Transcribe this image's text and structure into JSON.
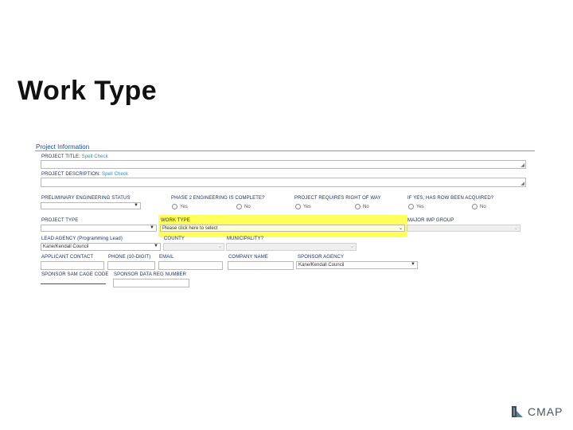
{
  "slide": {
    "title": "Work Type"
  },
  "form": {
    "section_title": "Project Information",
    "project_title": {
      "label": "PROJECT TITLE:",
      "spell": "Spell Check"
    },
    "project_description": {
      "label": "PROJECT DESCRIPTION:",
      "spell": "Spell Check"
    },
    "prelim_eng_status": {
      "label": "PRELIMINARY ENGINEERING STATUS"
    },
    "phase2_complete": {
      "label": "PHASE 2 ENGINEERING IS COMPLETE?",
      "yes": "Yes",
      "no": "No"
    },
    "requires_row": {
      "label": "PROJECT REQUIRES RIGHT OF WAY",
      "yes": "Yes",
      "no": "No"
    },
    "row_acquired": {
      "label": "IF YES, HAS ROW BEEN ACQUIRED?",
      "yes": "Yes",
      "no": "No"
    },
    "project_type": {
      "label": "PROJECT TYPE"
    },
    "work_type": {
      "label": "WORK TYPE",
      "value": "Please click here to select"
    },
    "major_imp_group": {
      "label": "MAJOR IMP GROUP"
    },
    "lead_agency": {
      "label": "LEAD AGENCY",
      "label_note": "(Programming Lead)",
      "value": "Kane/Kendall Council"
    },
    "county": {
      "label": "COUNTY"
    },
    "municipality": {
      "label": "MUNICIPALITY?"
    },
    "applicant_contact": {
      "label": "APPLICANT CONTACT"
    },
    "phone": {
      "label": "PHONE",
      "label_note": "(10-DIGIT)"
    },
    "email": {
      "label": "EMAIL"
    },
    "company_name": {
      "label": "COMPANY NAME"
    },
    "sponsor_agency": {
      "label": "SPONSOR AGENCY",
      "value": "Kane/Kendall Council"
    },
    "sponsor_sam": {
      "label": "SPONSOR SAM CAGE CODE"
    },
    "sponsor_data_reg": {
      "label": "SPONSOR DATA REG NUMBER"
    }
  },
  "logo": {
    "text": "CMAP",
    "icon": "cmap-logo-icon"
  }
}
